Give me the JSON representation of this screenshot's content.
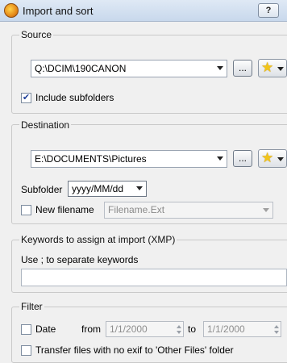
{
  "window": {
    "title": "Import and sort",
    "help_label": "?"
  },
  "source": {
    "group_label": "Source",
    "path": "Q:\\DCIM\\190CANON",
    "browse_label": "...",
    "include_subfolders_label": "Include subfolders",
    "include_subfolders_checked": true
  },
  "destination": {
    "group_label": "Destination",
    "path": "E:\\DOCUMENTS\\Pictures",
    "browse_label": "...",
    "subfolder_label": "Subfolder",
    "subfolder_value": "yyyy/MM/dd",
    "new_filename_label": "New filename",
    "new_filename_checked": false,
    "new_filename_value": "Filename.Ext"
  },
  "keywords": {
    "group_label": "Keywords to assign at import (XMP)",
    "hint": "Use ; to separate keywords",
    "value": ""
  },
  "filter": {
    "group_label": "Filter",
    "date_label": "Date",
    "date_checked": false,
    "from_label": "from",
    "from_value": "1/1/2000",
    "to_label": "to",
    "to_value": "1/1/2000",
    "transfer_no_exif_label": "Transfer files with no exif to 'Other Files' folder",
    "transfer_no_exif_checked": false
  }
}
